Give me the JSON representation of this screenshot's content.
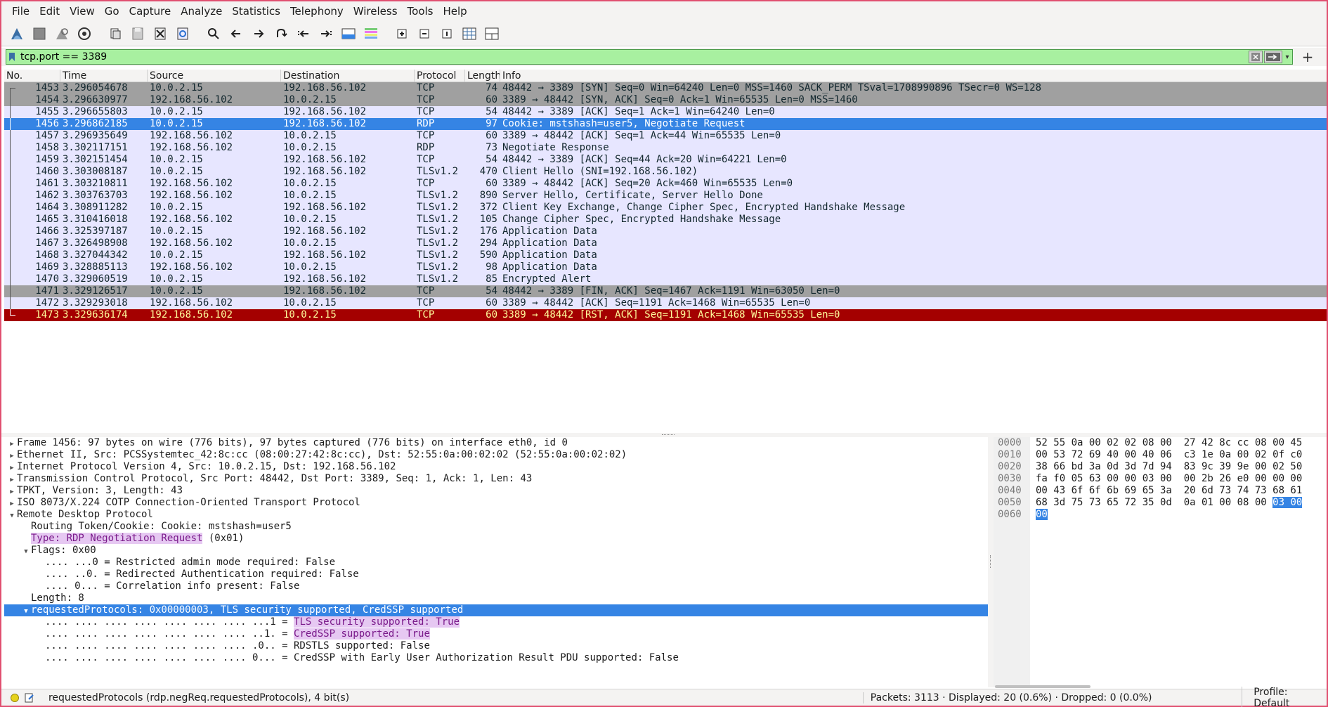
{
  "menu": [
    "File",
    "Edit",
    "View",
    "Go",
    "Capture",
    "Analyze",
    "Statistics",
    "Telephony",
    "Wireless",
    "Tools",
    "Help"
  ],
  "toolbar_icons": [
    "shark-fin-start-icon",
    "stop-icon",
    "restart-icon",
    "capture-options-icon",
    "open-file-icon",
    "save-file-icon",
    "close-file-icon",
    "reload-icon",
    "find-icon",
    "back-icon",
    "forward-icon",
    "go-to-packet-icon",
    "first-packet-icon",
    "last-packet-icon",
    "autoscroll-icon",
    "colorize-icon",
    "zoom-in-icon",
    "zoom-out-icon",
    "normal-size-icon",
    "resize-columns-icon",
    "layout-icon"
  ],
  "filter": {
    "value": "tcp.port == 3389",
    "valid_color": "#a8f0a0"
  },
  "columns": [
    "No.",
    "Time",
    "Source",
    "Destination",
    "Protocol",
    "Length",
    "Info"
  ],
  "packets": [
    {
      "no": "1453",
      "time": "3.296054678",
      "src": "10.0.2.15",
      "dst": "192.168.56.102",
      "proto": "TCP",
      "len": "74",
      "info": "48442 → 3389 [SYN] Seq=0 Win=64240 Len=0 MSS=1460 SACK_PERM TSval=1708990896 TSecr=0 WS=128",
      "style": "syn",
      "bracket": "top"
    },
    {
      "no": "1454",
      "time": "3.296630977",
      "src": "192.168.56.102",
      "dst": "10.0.2.15",
      "proto": "TCP",
      "len": "60",
      "info": "3389 → 48442 [SYN, ACK] Seq=0 Ack=1 Win=65535 Len=0 MSS=1460",
      "style": "syn",
      "bracket": "mid"
    },
    {
      "no": "1455",
      "time": "3.296655803",
      "src": "10.0.2.15",
      "dst": "192.168.56.102",
      "proto": "TCP",
      "len": "54",
      "info": "48442 → 3389 [ACK] Seq=1 Ack=1 Win=64240 Len=0",
      "style": "tcp",
      "bracket": "mid"
    },
    {
      "no": "1456",
      "time": "3.296862185",
      "src": "10.0.2.15",
      "dst": "192.168.56.102",
      "proto": "RDP",
      "len": "97",
      "info": "Cookie: mstshash=user5, Negotiate Request",
      "style": "sel",
      "bracket": "mid"
    },
    {
      "no": "1457",
      "time": "3.296935649",
      "src": "192.168.56.102",
      "dst": "10.0.2.15",
      "proto": "TCP",
      "len": "60",
      "info": "3389 → 48442 [ACK] Seq=1 Ack=44 Win=65535 Len=0",
      "style": "tcp",
      "bracket": "mid"
    },
    {
      "no": "1458",
      "time": "3.302117151",
      "src": "192.168.56.102",
      "dst": "10.0.2.15",
      "proto": "RDP",
      "len": "73",
      "info": "Negotiate Response",
      "style": "tcp",
      "bracket": "mid"
    },
    {
      "no": "1459",
      "time": "3.302151454",
      "src": "10.0.2.15",
      "dst": "192.168.56.102",
      "proto": "TCP",
      "len": "54",
      "info": "48442 → 3389 [ACK] Seq=44 Ack=20 Win=64221 Len=0",
      "style": "tcp",
      "bracket": "mid"
    },
    {
      "no": "1460",
      "time": "3.303008187",
      "src": "10.0.2.15",
      "dst": "192.168.56.102",
      "proto": "TLSv1.2",
      "len": "470",
      "info": "Client Hello (SNI=192.168.56.102)",
      "style": "tls",
      "bracket": "mid"
    },
    {
      "no": "1461",
      "time": "3.303210811",
      "src": "192.168.56.102",
      "dst": "10.0.2.15",
      "proto": "TCP",
      "len": "60",
      "info": "3389 → 48442 [ACK] Seq=20 Ack=460 Win=65535 Len=0",
      "style": "tcp",
      "bracket": "mid"
    },
    {
      "no": "1462",
      "time": "3.303763703",
      "src": "192.168.56.102",
      "dst": "10.0.2.15",
      "proto": "TLSv1.2",
      "len": "890",
      "info": "Server Hello, Certificate, Server Hello Done",
      "style": "tls",
      "bracket": "mid"
    },
    {
      "no": "1464",
      "time": "3.308911282",
      "src": "10.0.2.15",
      "dst": "192.168.56.102",
      "proto": "TLSv1.2",
      "len": "372",
      "info": "Client Key Exchange, Change Cipher Spec, Encrypted Handshake Message",
      "style": "tls",
      "bracket": "mid"
    },
    {
      "no": "1465",
      "time": "3.310416018",
      "src": "192.168.56.102",
      "dst": "10.0.2.15",
      "proto": "TLSv1.2",
      "len": "105",
      "info": "Change Cipher Spec, Encrypted Handshake Message",
      "style": "tls",
      "bracket": "mid"
    },
    {
      "no": "1466",
      "time": "3.325397187",
      "src": "10.0.2.15",
      "dst": "192.168.56.102",
      "proto": "TLSv1.2",
      "len": "176",
      "info": "Application Data",
      "style": "tls",
      "bracket": "mid"
    },
    {
      "no": "1467",
      "time": "3.326498908",
      "src": "192.168.56.102",
      "dst": "10.0.2.15",
      "proto": "TLSv1.2",
      "len": "294",
      "info": "Application Data",
      "style": "tls",
      "bracket": "mid"
    },
    {
      "no": "1468",
      "time": "3.327044342",
      "src": "10.0.2.15",
      "dst": "192.168.56.102",
      "proto": "TLSv1.2",
      "len": "590",
      "info": "Application Data",
      "style": "tls",
      "bracket": "mid"
    },
    {
      "no": "1469",
      "time": "3.328885113",
      "src": "192.168.56.102",
      "dst": "10.0.2.15",
      "proto": "TLSv1.2",
      "len": "98",
      "info": "Application Data",
      "style": "tls",
      "bracket": "mid"
    },
    {
      "no": "1470",
      "time": "3.329060519",
      "src": "10.0.2.15",
      "dst": "192.168.56.102",
      "proto": "TLSv1.2",
      "len": "85",
      "info": "Encrypted Alert",
      "style": "tls",
      "bracket": "mid"
    },
    {
      "no": "1471",
      "time": "3.329126517",
      "src": "10.0.2.15",
      "dst": "192.168.56.102",
      "proto": "TCP",
      "len": "54",
      "info": "48442 → 3389 [FIN, ACK] Seq=1467 Ack=1191 Win=63050 Len=0",
      "style": "syn",
      "bracket": "mid"
    },
    {
      "no": "1472",
      "time": "3.329293018",
      "src": "192.168.56.102",
      "dst": "10.0.2.15",
      "proto": "TCP",
      "len": "60",
      "info": "3389 → 48442 [ACK] Seq=1191 Ack=1468 Win=65535 Len=0",
      "style": "tcp",
      "bracket": "mid"
    },
    {
      "no": "1473",
      "time": "3.329636174",
      "src": "192.168.56.102",
      "dst": "10.0.2.15",
      "proto": "TCP",
      "len": "60",
      "info": "3389 → 48442 [RST, ACK] Seq=1191 Ack=1468 Win=65535 Len=0",
      "style": "rst",
      "bracket": "bot"
    }
  ],
  "details": {
    "frame": "Frame 1456: 97 bytes on wire (776 bits), 97 bytes captured (776 bits) on interface eth0, id 0",
    "ethernet": "Ethernet II, Src: PCSSystemtec_42:8c:cc (08:00:27:42:8c:cc), Dst: 52:55:0a:00:02:02 (52:55:0a:00:02:02)",
    "ip": "Internet Protocol Version 4, Src: 10.0.2.15, Dst: 192.168.56.102",
    "tcp": "Transmission Control Protocol, Src Port: 48442, Dst Port: 3389, Seq: 1, Ack: 1, Len: 43",
    "tpkt": "TPKT, Version: 3, Length: 43",
    "cotp": "ISO 8073/X.224 COTP Connection-Oriented Transport Protocol",
    "rdp": "Remote Desktop Protocol",
    "routing_token": "Routing Token/Cookie: Cookie: mstshash=user5",
    "type_label": "Type: RDP Negotiation Request",
    "type_value": " (0x01)",
    "flags": "Flags: 0x00",
    "flag1": ".... ...0 = Restricted admin mode required: False",
    "flag2": ".... ..0. = Redirected Authentication required: False",
    "flag3": ".... 0... = Correlation info present: False",
    "length": "Length: 8",
    "requested": "requestedProtocols: 0x00000003, TLS security supported, CredSSP supported",
    "rp1_bits": ".... .... .... .... .... .... .... ...1 = ",
    "rp1_label": "TLS security supported: True",
    "rp2_bits": ".... .... .... .... .... .... .... ..1. = ",
    "rp2_label": "CredSSP supported: True",
    "rp3": ".... .... .... .... .... .... .... .0.. = RDSTLS supported: False",
    "rp4": ".... .... .... .... .... .... .... 0... = CredSSP with Early User Authorization Result PDU supported: False"
  },
  "hex": {
    "offsets": [
      "0000",
      "0010",
      "0020",
      "0030",
      "0040",
      "0050",
      "0060"
    ],
    "rows": [
      "52 55 0a 00 02 02 08 00  27 42 8c cc 08 00 45",
      "00 53 72 69 40 00 40 06  c3 1e 0a 00 02 0f c0",
      "38 66 bd 3a 0d 3d 7d 94  83 9c 39 9e 00 02 50",
      "fa f0 05 63 00 00 03 00  00 2b 26 e0 00 00 00",
      "00 43 6f 6f 6b 69 65 3a  20 6d 73 74 73 68 61",
      "68 3d 75 73 65 72 35 0d  0a 01 00 08 00 ",
      ""
    ],
    "row5_sel": "03 00",
    "row6_sel": "00"
  },
  "status": {
    "field": "requestedProtocols (rdp.negReq.requestedProtocols), 4 bit(s)",
    "counts": "Packets: 3113 · Displayed: 20 (0.6%) · Dropped: 0 (0.0%)",
    "profile": "Profile: Default"
  }
}
